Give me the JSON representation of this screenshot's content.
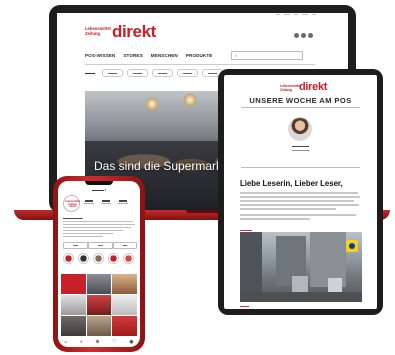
{
  "laptop": {
    "logo_small": "Lebensmittel Zeitung",
    "logo_big": "direkt",
    "nav": [
      "POS-WISSEN",
      "STORES",
      "MENSCHEN",
      "PRODUKTE"
    ],
    "hero_headline": "Das sind die Supermarkt"
  },
  "tablet": {
    "logo_small": "Lebensmittel Zeitung",
    "logo_big": "direkt",
    "title": "UNSERE WOCHE AM POS",
    "greeting": "Liebe Leserin, Lieber Leser,"
  },
  "phone": {
    "profile_logo": "Lebensmittel Zeitung direkt"
  },
  "colors": {
    "brand_red": "#c8202a",
    "device_dark": "#1e1e1e"
  }
}
